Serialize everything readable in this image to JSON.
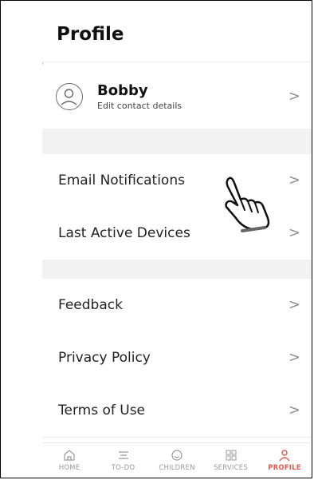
{
  "header": {
    "title": "Profile"
  },
  "profile": {
    "name": "Bobby",
    "subtitle": "Edit contact details",
    "chevron": ">"
  },
  "menu": {
    "email_notifications": "Email Notifications",
    "last_active_devices": "Last Active Devices",
    "feedback": "Feedback",
    "privacy_policy": "Privacy Policy",
    "terms_of_use": "Terms of Use",
    "chevron": ">"
  },
  "tabs": [
    {
      "label": "HOME",
      "icon": "home-icon"
    },
    {
      "label": "TO-DO",
      "icon": "list-icon"
    },
    {
      "label": "CHILDREN",
      "icon": "child-icon"
    },
    {
      "label": "SERVICES",
      "icon": "grid-icon"
    },
    {
      "label": "PROFILE",
      "icon": "person-icon",
      "active": true
    }
  ],
  "colors": {
    "accent": "#e85a4f",
    "separator": "#f2f2f2",
    "muted": "#9a9a9a"
  }
}
